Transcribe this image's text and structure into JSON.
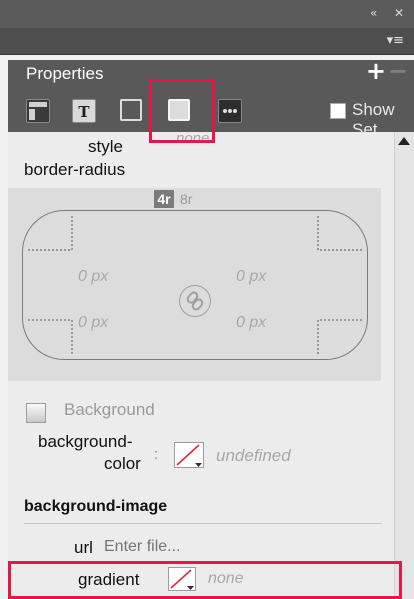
{
  "window": {
    "collapse_glyph": "«",
    "close_glyph": "✕",
    "menu_glyph": "▾≡"
  },
  "panel": {
    "title": "Properties",
    "add_glyph": "+",
    "remove_glyph": "−"
  },
  "toolbar": {
    "show_set_label": "Show Set"
  },
  "style": {
    "label": "style",
    "value": "none"
  },
  "border_radius": {
    "label": "border-radius",
    "mode_4r": "4r",
    "mode_8r": "8r",
    "top_left": "0 px",
    "top_right": "0 px",
    "bottom_left": "0 px",
    "bottom_right": "0 px"
  },
  "background": {
    "section_label": "Background",
    "color_label_line1": "background-",
    "color_label_line2": "color",
    "color_separator": ":",
    "color_value": "undefined"
  },
  "background_image": {
    "heading": "background-image",
    "url_label": "url",
    "url_placeholder": "Enter file...",
    "gradient_label": "gradient",
    "gradient_value": "none"
  },
  "colors": {
    "highlight": "#e5174a",
    "header": "#595959"
  }
}
